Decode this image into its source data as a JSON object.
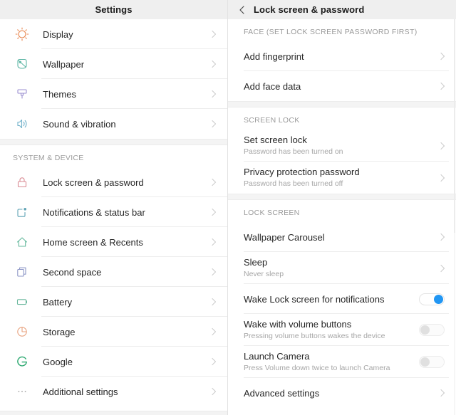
{
  "left_panel": {
    "title": "Settings",
    "groups": [
      {
        "header": null,
        "items": [
          {
            "label": "Display",
            "icon": "sun-icon",
            "color": "#e8864f"
          },
          {
            "label": "Wallpaper",
            "icon": "wallpaper-icon",
            "color": "#5fb7a6"
          },
          {
            "label": "Themes",
            "icon": "paintbrush-icon",
            "color": "#9b8fd0"
          },
          {
            "label": "Sound & vibration",
            "icon": "speaker-icon",
            "color": "#6fb0c9"
          }
        ]
      },
      {
        "header": "SYSTEM & DEVICE",
        "items": [
          {
            "label": "Lock screen & password",
            "icon": "lock-icon",
            "color": "#d98a93"
          },
          {
            "label": "Notifications & status bar",
            "icon": "notification-icon",
            "color": "#5fa3b5"
          },
          {
            "label": "Home screen & Recents",
            "icon": "home-icon",
            "color": "#63b89c"
          },
          {
            "label": "Second space",
            "icon": "copy-icon",
            "color": "#8e97c7"
          },
          {
            "label": "Battery",
            "icon": "battery-icon",
            "color": "#6bb89e"
          },
          {
            "label": "Storage",
            "icon": "pie-chart-icon",
            "color": "#e8a27e"
          },
          {
            "label": "Google",
            "icon": "google-g-icon",
            "color": "#2aa86f"
          },
          {
            "label": "Additional settings",
            "icon": "ellipsis-icon",
            "color": "#b0b0b0"
          }
        ]
      }
    ]
  },
  "right_panel": {
    "title": "Lock screen & password",
    "back_icon": "chevron-left-icon",
    "groups": [
      {
        "header": "FACE (SET LOCK SCREEN PASSWORD FIRST)",
        "items": [
          {
            "title": "Add fingerprint",
            "subtitle": null,
            "control": "chevron"
          },
          {
            "title": "Add face data",
            "subtitle": null,
            "control": "chevron"
          }
        ]
      },
      {
        "header": "SCREEN LOCK",
        "items": [
          {
            "title": "Set screen lock",
            "subtitle": "Password has been turned on",
            "control": "chevron"
          },
          {
            "title": "Privacy protection password",
            "subtitle": "Password has been turned off",
            "control": "chevron"
          }
        ]
      },
      {
        "header": "LOCK SCREEN",
        "items": [
          {
            "title": "Wallpaper Carousel",
            "subtitle": null,
            "control": "chevron"
          },
          {
            "title": "Sleep",
            "subtitle": "Never sleep",
            "control": "chevron"
          },
          {
            "title": "Wake Lock screen for notifications",
            "subtitle": null,
            "control": "toggle",
            "toggle_state": "on"
          },
          {
            "title": "Wake with volume buttons",
            "subtitle": "Pressing volume buttons wakes the device",
            "control": "toggle",
            "toggle_state": "off"
          },
          {
            "title": "Launch Camera",
            "subtitle": "Press Volume down twice to launch Camera",
            "control": "toggle",
            "toggle_state": "off"
          },
          {
            "title": "Advanced settings",
            "subtitle": null,
            "control": "chevron"
          }
        ]
      }
    ]
  },
  "colors": {
    "titlebar_bg": "#efefef",
    "accent_toggle_on": "#2196f3",
    "text_primary": "#262626",
    "text_secondary": "#a6a6a6",
    "divider": "#ededed"
  }
}
